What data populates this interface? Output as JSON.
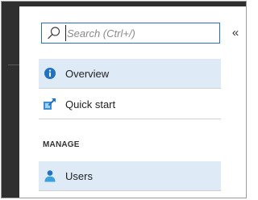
{
  "search": {
    "placeholder": "Search (Ctrl+/)",
    "value": ""
  },
  "collapse": {
    "label": "«"
  },
  "nav": {
    "items": [
      {
        "label": "Overview",
        "icon": "info-icon",
        "selected": true
      },
      {
        "label": "Quick start",
        "icon": "quickstart-icon",
        "selected": false
      }
    ],
    "section": {
      "heading": "MANAGE",
      "items": [
        {
          "label": "Users",
          "icon": "user-icon",
          "selected": true
        }
      ]
    }
  },
  "colors": {
    "accent": "#2a6fb5",
    "selected_bg": "#deebf7",
    "chrome_dark": "#2f2f2f"
  }
}
